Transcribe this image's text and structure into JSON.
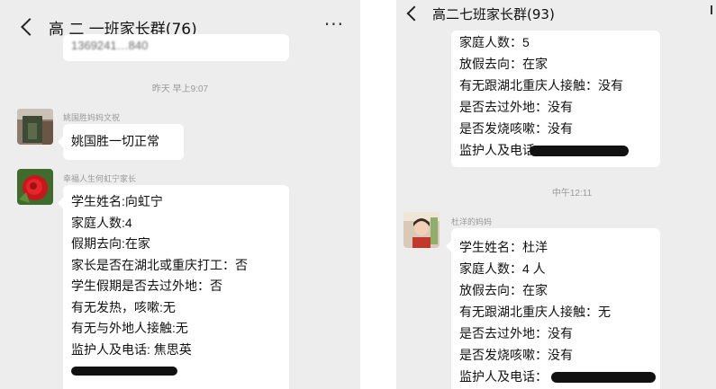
{
  "left": {
    "title": "高 二 一班家长群(76)",
    "more_label": "···",
    "top_partial_text": "1369241…840",
    "time_1": "昨天 早上9:07",
    "msg1": {
      "sender": "姚国胜妈妈文祝",
      "text": "姚国胜一切正常"
    },
    "msg2": {
      "sender": "幸福人生何虹宁家长",
      "lines": [
        "学生姓名:向虹宁",
        "家庭人数:4",
        "假期去向:在家",
        "家长是否在湖北或重庆打工：否",
        "学生假期是否去过外地：否",
        "有无发热，咳嗽:无",
        "有无与外地人接触:无",
        "监护人及电话: 焦思英"
      ]
    }
  },
  "right": {
    "title": "高二七班家长群(93)",
    "cont_lines": [
      "家庭人数：5",
      "放假去向：在家",
      "有无跟湖北重庆人接触：没有",
      "是否去过外地：没有",
      "是否发烧咳嗽：没有",
      "监护人及电话"
    ],
    "time_2": "中午12:11",
    "msg3": {
      "sender": "杜洋的妈妈",
      "lines": [
        "学生姓名：杜洋",
        "家庭人数：4 人",
        "放假去向：在家",
        "有无跟湖北重庆人接触：无",
        "是否去过外地：没有",
        "是否发烧咳嗽：没有",
        "监护人及电话："
      ]
    }
  },
  "colors": {
    "chat_background": "#ededed",
    "bubble": "#ffffff",
    "meta_text": "#9a9a9a"
  },
  "icons": [
    "back-icon",
    "more-icon"
  ]
}
